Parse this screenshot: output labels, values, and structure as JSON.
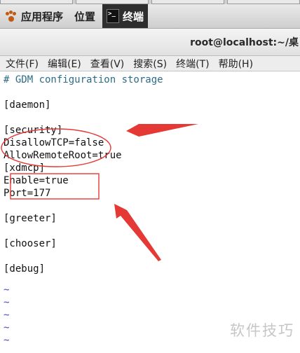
{
  "panel": {
    "applications_label": "应用程序",
    "places_label": "位置",
    "terminal_label": "终端"
  },
  "window": {
    "title": "root@localhost:~/桌"
  },
  "menubar": {
    "items": [
      {
        "label": "文件(F)"
      },
      {
        "label": "编辑(E)"
      },
      {
        "label": "查看(V)"
      },
      {
        "label": "搜索(S)"
      },
      {
        "label": "终端(T)"
      },
      {
        "label": "帮助(H)"
      }
    ]
  },
  "editor": {
    "lines": [
      "# GDM configuration storage",
      "",
      "[daemon]",
      "",
      "[security]",
      "DisallowTCP=false",
      "AllowRemoteRoot=true",
      "[xdmcp]",
      "Enable=true",
      "Port=177",
      "",
      "[greeter]",
      "",
      "[chooser]",
      "",
      "[debug]",
      "",
      "~",
      "~",
      "~",
      "~",
      "~"
    ]
  },
  "watermark": "软件技巧",
  "colors": {
    "annotation_red": "#e53935",
    "comment_blue": "#2d6c89",
    "tilde_blue": "#4a4ac8"
  }
}
